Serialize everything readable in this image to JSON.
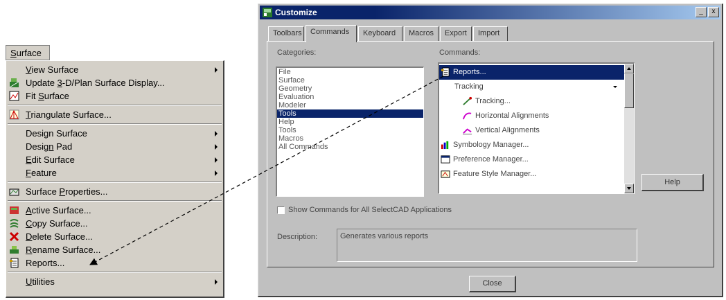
{
  "menu": {
    "title": "Surface",
    "title_underline": "S",
    "groups": [
      [
        {
          "pre": "",
          "ul": "V",
          "post": "iew Surface",
          "submenu": true,
          "icon": ""
        },
        {
          "pre": "Update ",
          "ul": "3",
          "post": "-D/Plan Surface Display...",
          "submenu": false,
          "icon": "update-display-icon"
        },
        {
          "pre": "Fit ",
          "ul": "S",
          "post": "urface",
          "submenu": false,
          "icon": "fit-surface-icon"
        }
      ],
      [
        {
          "pre": "",
          "ul": "T",
          "post": "riangulate Surface...",
          "submenu": false,
          "icon": "triangulate-icon"
        }
      ],
      [
        {
          "pre": "Desi",
          "ul": "g",
          "post": "n Surface",
          "submenu": true,
          "icon": ""
        },
        {
          "pre": "Desig",
          "ul": "n",
          "post": " Pad",
          "submenu": true,
          "icon": ""
        },
        {
          "pre": "",
          "ul": "E",
          "post": "dit Surface",
          "submenu": true,
          "icon": ""
        },
        {
          "pre": "",
          "ul": "F",
          "post": "eature",
          "submenu": true,
          "icon": ""
        }
      ],
      [
        {
          "pre": "Surface ",
          "ul": "P",
          "post": "roperties...",
          "submenu": false,
          "icon": "surface-properties-icon"
        }
      ],
      [
        {
          "pre": "",
          "ul": "A",
          "post": "ctive Surface...",
          "submenu": false,
          "icon": "active-surface-icon"
        },
        {
          "pre": "",
          "ul": "C",
          "post": "opy Surface...",
          "submenu": false,
          "icon": "copy-surface-icon"
        },
        {
          "pre": "",
          "ul": "D",
          "post": "elete Surface...",
          "submenu": false,
          "icon": "delete-surface-icon"
        },
        {
          "pre": "",
          "ul": "R",
          "post": "ename Surface...",
          "submenu": false,
          "icon": "rename-surface-icon"
        },
        {
          "pre": "Reports...",
          "ul": "",
          "post": "",
          "submenu": false,
          "icon": "reports-icon"
        }
      ],
      [
        {
          "pre": "",
          "ul": "U",
          "post": "tilities",
          "submenu": true,
          "icon": ""
        }
      ]
    ]
  },
  "dialog": {
    "title": "Customize",
    "tabs": [
      "Toolbars",
      "Commands",
      "Keyboard",
      "Macros",
      "Export",
      "Import"
    ],
    "active_tab": 1,
    "categories_label": "Categories:",
    "categories": [
      "File",
      "Surface",
      "Geometry",
      "Evaluation",
      "Modeler",
      "Tools",
      "Help",
      "Tools",
      "Macros",
      "All Commands"
    ],
    "selected_category": 5,
    "commands_label": "Commands:",
    "commands": [
      {
        "label": "Reports...",
        "indent": 0,
        "icon": "reports-icon",
        "selected": true,
        "caret": false
      },
      {
        "label": "Tracking",
        "indent": 1,
        "icon": "",
        "selected": false,
        "caret": true
      },
      {
        "label": "Tracking...",
        "indent": 2,
        "icon": "tracking-icon",
        "selected": false,
        "caret": false
      },
      {
        "label": "Horizontal Alignments",
        "indent": 2,
        "icon": "horizontal-alignment-icon",
        "selected": false,
        "caret": false
      },
      {
        "label": "Vertical Alignments",
        "indent": 2,
        "icon": "vertical-alignment-icon",
        "selected": false,
        "caret": false
      },
      {
        "label": "Symbology Manager...",
        "indent": 0,
        "icon": "symbology-icon",
        "selected": false,
        "caret": false
      },
      {
        "label": "Preference Manager...",
        "indent": 0,
        "icon": "preference-icon",
        "selected": false,
        "caret": false
      },
      {
        "label": "Feature Style Manager...",
        "indent": 0,
        "icon": "feature-style-icon",
        "selected": false,
        "caret": false
      }
    ],
    "help_button": "Help",
    "checkbox_label": "Show Commands for All SelectCAD Applications",
    "description_label": "Description:",
    "description_text": "Generates various reports",
    "close_button": "Close",
    "title_buttons": [
      "_",
      "x"
    ]
  },
  "colors": {
    "face": "#c0c0c0",
    "selection": "#0a246a",
    "titlebar_start": "#0a246a",
    "titlebar_end": "#a6caf0"
  }
}
